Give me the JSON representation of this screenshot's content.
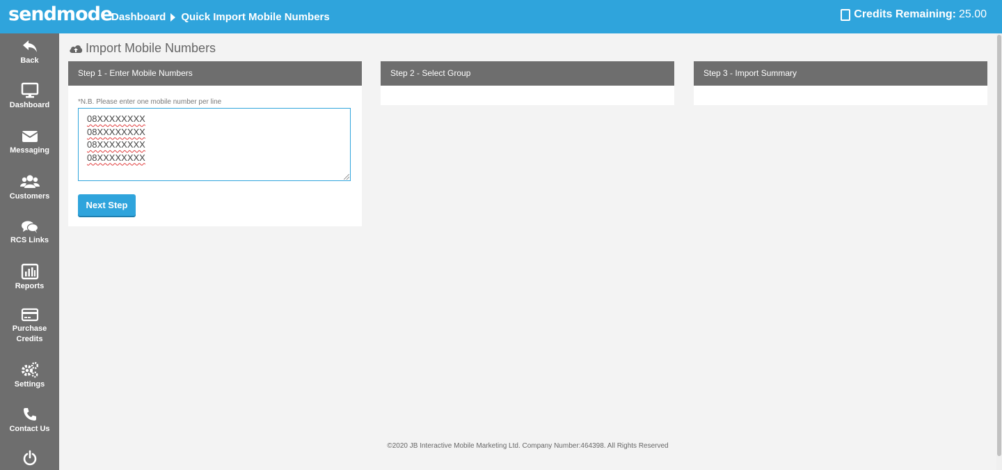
{
  "brand": {
    "logo": "sendmode",
    "primary_color": "#2fa4dc",
    "sidebar_color": "#6e6e6e"
  },
  "header": {
    "breadcrumb": [
      "Dashboard",
      "Quick Import Mobile Numbers"
    ],
    "credits_label": "Credits Remaining:",
    "credits_value": "25.00",
    "credits_icon": "tablet-icon"
  },
  "sidebar": {
    "items": [
      {
        "label": "Back",
        "icon": "reply-icon"
      },
      {
        "label": "Dashboard",
        "icon": "desktop-icon"
      },
      {
        "label": "Messaging",
        "icon": "envelope-icon"
      },
      {
        "label": "Customers",
        "icon": "users-icon"
      },
      {
        "label": "RCS Links",
        "icon": "comments-icon"
      },
      {
        "label": "Reports",
        "icon": "bar-chart-icon"
      },
      {
        "label": "Purchase Credits",
        "icon": "credit-card-icon"
      },
      {
        "label": "Settings",
        "icon": "cogs-icon"
      },
      {
        "label": "Contact Us",
        "icon": "phone-icon"
      },
      {
        "label": "",
        "icon": "power-icon"
      }
    ]
  },
  "page": {
    "title": "Import Mobile Numbers",
    "title_icon": "cloud-upload-icon"
  },
  "steps": [
    {
      "title": "Step 1 - Enter Mobile Numbers"
    },
    {
      "title": "Step 2 - Select Group"
    },
    {
      "title": "Step 3 - Import Summary"
    }
  ],
  "step1": {
    "note": "*N.B. Please enter one mobile number per line",
    "numbers": [
      "08XXXXXXXX",
      "08XXXXXXXX",
      "08XXXXXXXX",
      "08XXXXXXXX"
    ],
    "next_button": "Next Step"
  },
  "footer": {
    "text": "©2020 JB Interactive Mobile Marketing Ltd. Company Number:464398. All Rights Reserved"
  }
}
